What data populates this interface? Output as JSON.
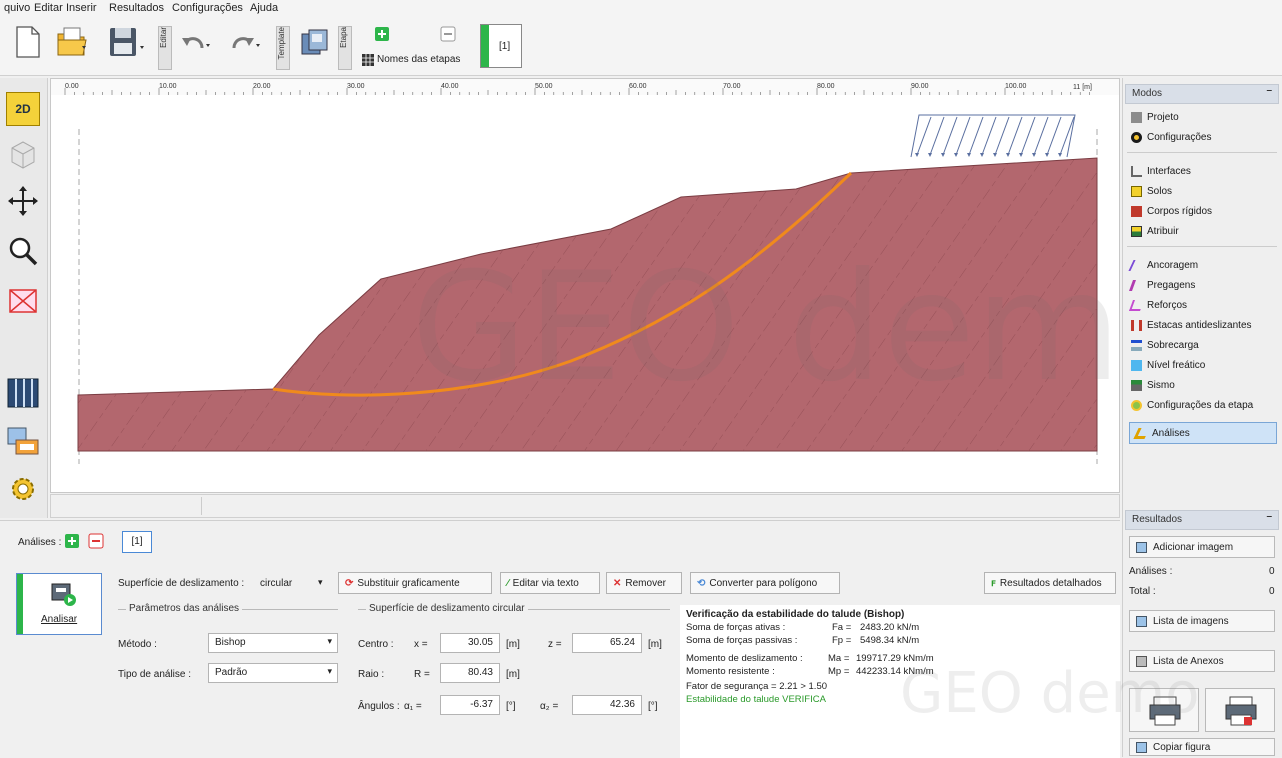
{
  "menu": [
    "quivo",
    "Editar",
    "Inserir",
    "Resultados",
    "Configurações",
    "Ajuda"
  ],
  "toolbar": {
    "editar_label": "Editar",
    "template_label": "Template",
    "etapa_label": "Etapa",
    "stage_names_label": "Nomes das etapas",
    "stage_tab": "[1]"
  },
  "leftbar": {
    "mode_2d": "2D"
  },
  "ruler": {
    "ticks": [
      "0.00",
      "10.00",
      "20.00",
      "30.00",
      "40.00",
      "50.00",
      "60.00",
      "70.00",
      "80.00",
      "90.00",
      "100.00"
    ],
    "end_label": "11 [m]"
  },
  "canvas": {
    "watermark": "GEO demo"
  },
  "right_panel": {
    "modes_title": "Modos",
    "modes_group1": [
      "Projeto",
      "Configurações"
    ],
    "modes_group2": [
      "Interfaces",
      "Solos",
      "Corpos rígidos",
      "Atribuir"
    ],
    "modes_group3": [
      "Ancoragem",
      "Pregagens",
      "Reforços",
      "Estacas antideslizantes",
      "Sobrecarga",
      "Nível freático",
      "Sismo",
      "Configurações da etapa"
    ],
    "active_mode": "Análises",
    "results_title": "Resultados",
    "add_image": "Adicionar imagem",
    "analyses_label": "Análises :",
    "analyses_count": "0",
    "total_label": "Total :",
    "total_count": "0",
    "image_list": "Lista de imagens",
    "annex_list": "Lista de Anexos",
    "copy_figure": "Copiar figura"
  },
  "analysis": {
    "header_label": "Análises :",
    "stage_tab": "[1]",
    "analyze_button": "Analisar",
    "surface_label": "Superfície de deslizamento :",
    "surface_value": "circular",
    "btn_substituir": "Substituir graficamente",
    "btn_editar": "Editar via texto",
    "btn_remover": "Remover",
    "btn_converter": "Converter para polígono",
    "btn_resultados": "Resultados detalhados",
    "params_group": "Parâmetros das análises",
    "method_label": "Método :",
    "method_value": "Bishop",
    "type_label": "Tipo de análise :",
    "type_value": "Padrão",
    "surface_group": "Superfície de deslizamento circular",
    "center_label": "Centro :",
    "x_label": "x =",
    "x_value": "30.05",
    "z_label": "z =",
    "z_value": "65.24",
    "unit_m": "[m]",
    "radius_label": "Raio :",
    "r_label": "R =",
    "r_value": "80.43",
    "angles_label": "Ângulos :",
    "a1_label": "α₁ =",
    "a1_value": "-6.37",
    "a2_label": "α₂ =",
    "a2_value": "42.36",
    "unit_deg": "[°]",
    "result_title": "Verificação da estabilidade do talude (Bishop)",
    "sum_active_label": "Soma de forças ativas :",
    "sum_active_sym": "Fa =",
    "sum_active_value": "2483.20 kN/m",
    "sum_passive_label": "Soma de forças passivas :",
    "sum_passive_sym": "Fp =",
    "sum_passive_value": "5498.34 kN/m",
    "slide_moment_label": "Momento de deslizamento :",
    "slide_moment_sym": "Ma =",
    "slide_moment_value": "199717.29 kNm/m",
    "resist_moment_label": "Momento resistente :",
    "resist_moment_sym": "Mp =",
    "resist_moment_value": "442233.14 kNm/m",
    "safety_factor": "Fator de segurança = 2.21 > 1.50",
    "verdict": "Estabilidade do talude VERIFICA",
    "watermark": "GEO demo"
  },
  "colors": {
    "soil": "#b3676e",
    "slip_surface": "#f08a1c",
    "verdict_green": "#2a9a2a",
    "accent_green": "#2db54a"
  }
}
